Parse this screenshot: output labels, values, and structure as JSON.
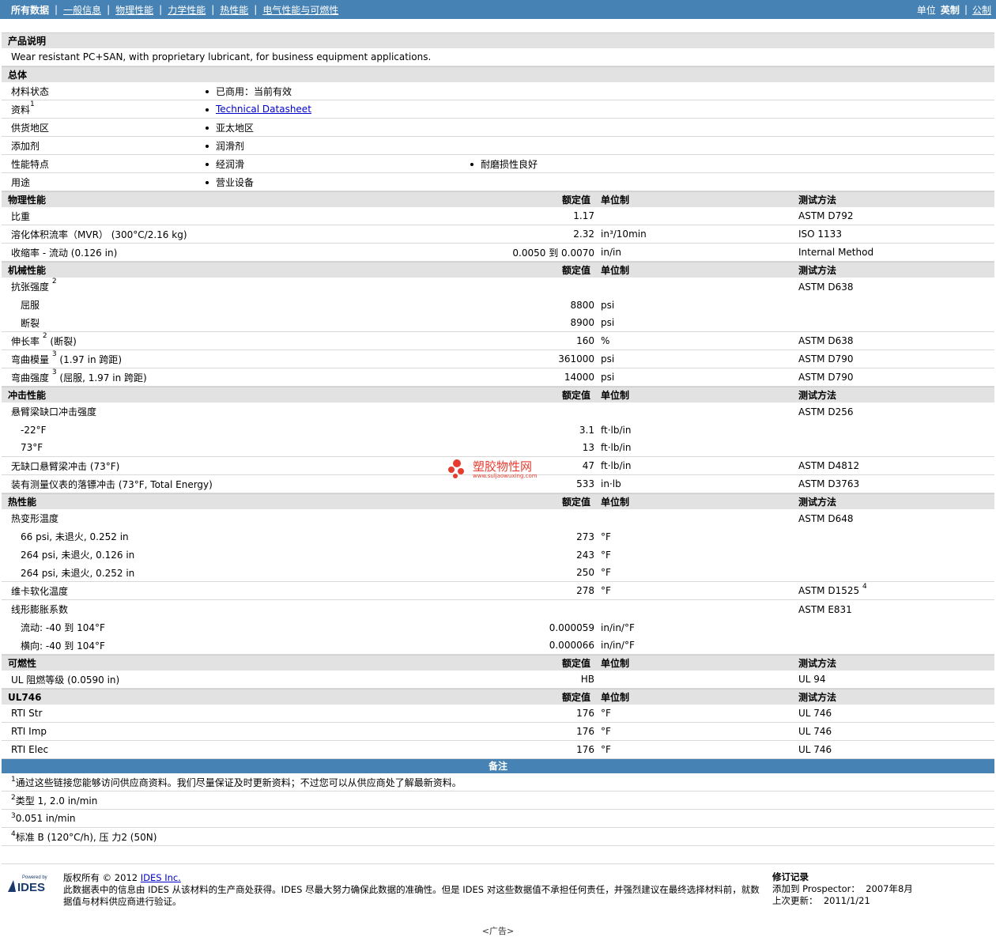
{
  "nav": {
    "tabs": [
      "所有数据",
      "一般信息",
      "物理性能",
      "力学性能",
      "热性能",
      "电气性能与可燃性"
    ],
    "units_label": "单位",
    "units_selected": "英制",
    "units_other": "公制"
  },
  "headers": {
    "value": "额定值",
    "unit": "单位制",
    "test": "测试方法"
  },
  "product_description": {
    "title": "产品说明",
    "text": "Wear resistant PC+SAN, with proprietary lubricant, for business equipment applications."
  },
  "general": {
    "title": "总体",
    "rows": [
      {
        "label": "材料状态",
        "values": [
          "已商用：当前有效"
        ]
      },
      {
        "label": "资料",
        "sup": "1",
        "link": "Technical Datasheet"
      },
      {
        "label": "供货地区",
        "values": [
          "亚太地区"
        ]
      },
      {
        "label": "添加剂",
        "values": [
          "润滑剂"
        ]
      },
      {
        "label": "性能特点",
        "values": [
          "经润滑",
          "耐磨损性良好"
        ]
      },
      {
        "label": "用途",
        "values": [
          "营业设备"
        ]
      }
    ]
  },
  "physical": {
    "title": "物理性能",
    "rows": [
      {
        "label": "比重",
        "value": "1.17",
        "unit": "",
        "test": "ASTM D792"
      },
      {
        "label": "溶化体积流率（MVR） (300°C/2.16 kg)",
        "value": "2.32",
        "unit": "in³/10min",
        "test": "ISO 1133"
      },
      {
        "label": "收缩率 - 流动 (0.126 in)",
        "value": "0.0050 到  0.0070",
        "unit": "in/in",
        "test": "Internal Method"
      }
    ]
  },
  "mechanical": {
    "title": "机械性能",
    "rows": [
      {
        "label": "抗张强度",
        "sup": "2",
        "value": "",
        "unit": "",
        "test": "ASTM D638"
      },
      {
        "label": "屈服",
        "sub": true,
        "value": "8800",
        "unit": "psi",
        "test": ""
      },
      {
        "label": "断裂",
        "sub": true,
        "value": "8900",
        "unit": "psi",
        "test": ""
      },
      {
        "label": "伸长率",
        "sup": "2",
        "suffix": "(断裂)",
        "value": "160",
        "unit": "%",
        "test": "ASTM D638"
      },
      {
        "label": "弯曲模量",
        "sup": "3",
        "suffix": "(1.97 in 跨距)",
        "value": "361000",
        "unit": "psi",
        "test": "ASTM D790"
      },
      {
        "label": "弯曲强度",
        "sup": "3",
        "suffix": "(屈服, 1.97 in 跨距)",
        "value": "14000",
        "unit": "psi",
        "test": "ASTM D790"
      }
    ]
  },
  "impact": {
    "title": "冲击性能",
    "rows": [
      {
        "label": "悬臂梁缺口冲击强度",
        "value": "",
        "unit": "",
        "test": "ASTM D256"
      },
      {
        "label": "-22°F",
        "sub": true,
        "value": "3.1",
        "unit": "ft·lb/in",
        "test": ""
      },
      {
        "label": "73°F",
        "sub": true,
        "value": "13",
        "unit": "ft·lb/in",
        "test": ""
      },
      {
        "label": "无缺口悬臂梁冲击 (73°F)",
        "value": "47",
        "unit": "ft·lb/in",
        "test": "ASTM D4812"
      },
      {
        "label": "装有测量仪表的落镖冲击 (73°F, Total Energy)",
        "value": "533",
        "unit": "in·lb",
        "test": "ASTM D3763"
      }
    ]
  },
  "thermal": {
    "title": "热性能",
    "rows": [
      {
        "label": "热变形温度",
        "value": "",
        "unit": "",
        "test": "ASTM D648"
      },
      {
        "label": "66 psi, 未退火, 0.252 in",
        "sub": true,
        "value": "273",
        "unit": "°F",
        "test": ""
      },
      {
        "label": "264 psi, 未退火, 0.126 in",
        "sub": true,
        "value": "243",
        "unit": "°F",
        "test": ""
      },
      {
        "label": "264 psi, 未退火, 0.252 in",
        "sub": true,
        "value": "250",
        "unit": "°F",
        "test": ""
      },
      {
        "label": "维卡软化温度",
        "value": "278",
        "unit": "°F",
        "test": "ASTM D1525",
        "test_sup": "4"
      },
      {
        "label": "线形膨胀系数",
        "value": "",
        "unit": "",
        "test": "ASTM E831"
      },
      {
        "label": "流动: -40 到  104°F",
        "sub": true,
        "value": "0.000059",
        "unit": "in/in/°F",
        "test": ""
      },
      {
        "label": "横向: -40 到  104°F",
        "sub": true,
        "value": "0.000066",
        "unit": "in/in/°F",
        "test": ""
      }
    ]
  },
  "flammability": {
    "title": "可燃性",
    "rows": [
      {
        "label": "UL 阻燃等级 (0.0590 in)",
        "value": "HB",
        "unit": "",
        "test": "UL 94"
      }
    ]
  },
  "ul746": {
    "title": "UL746",
    "rows": [
      {
        "label": "RTI Str",
        "value": "176",
        "unit": "°F",
        "test": "UL 746"
      },
      {
        "label": "RTI Imp",
        "value": "176",
        "unit": "°F",
        "test": "UL 746"
      },
      {
        "label": "RTI Elec",
        "value": "176",
        "unit": "°F",
        "test": "UL 746"
      }
    ]
  },
  "notes": {
    "title": "备注",
    "items": [
      {
        "num": "1",
        "text": "通过这些链接您能够访问供应商资料。我们尽量保证及时更新资料；不过您可以从供应商处了解最新资料。"
      },
      {
        "num": "2",
        "text": "类型  1, 2.0 in/min"
      },
      {
        "num": "3",
        "text": "0.051 in/min"
      },
      {
        "num": "4",
        "text": "标准  B (120°C/h), 压  力2 (50N)"
      }
    ]
  },
  "footer": {
    "logo_text": "Powered by IDES",
    "copyright_prefix": "版权所有  © 2012 ",
    "company_link": "IDES Inc.",
    "disclaimer": "此数据表中的信息由  IDES 从该材料的生产商处获得。IDES 尽最大努力确保此数据的准确性。但是  IDES 对这些数据值不承担任何责任，并强烈建议在最终选择材料前，就数据值与材料供应商进行验证。",
    "revision_title": "修订记录",
    "added_label": "添加到  Prospector：",
    "added_value": "2007年8月",
    "updated_label": "上次更新：",
    "updated_value": "2011/1/21",
    "ad_text": "<广告>"
  },
  "watermark": {
    "text": "塑胶物性网",
    "url": "www.suljaowuxing.com"
  }
}
